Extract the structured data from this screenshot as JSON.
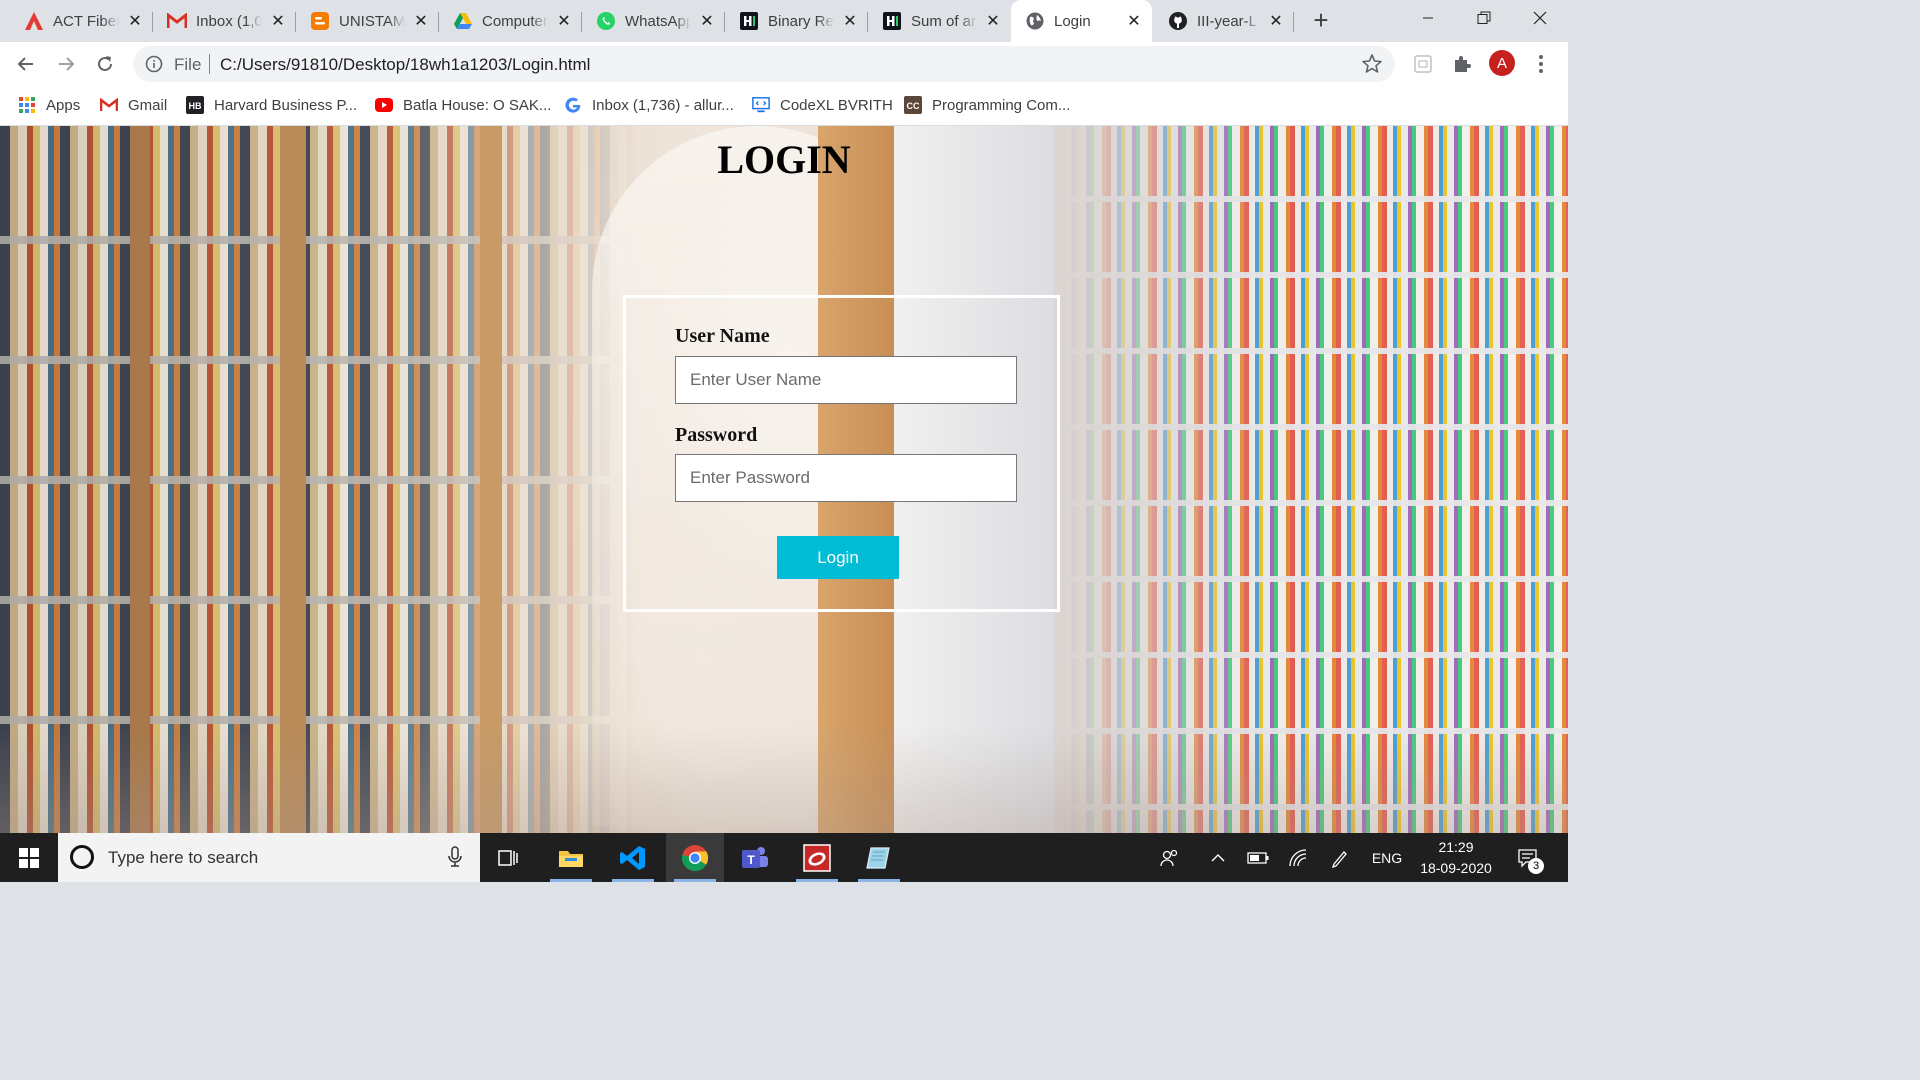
{
  "browser": {
    "tabs": [
      {
        "title": "ACT Fiber",
        "icon": "act-logo"
      },
      {
        "title": "Inbox (1,0",
        "icon": "gmail-icon"
      },
      {
        "title": "UNISTAM",
        "icon": "blogger-icon"
      },
      {
        "title": "Computer",
        "icon": "drive-icon"
      },
      {
        "title": "WhatsApp",
        "icon": "whatsapp-icon"
      },
      {
        "title": "Binary Re",
        "icon": "hackerrank-icon"
      },
      {
        "title": "Sum of ar",
        "icon": "hackerrank-icon"
      },
      {
        "title": "Login",
        "icon": "globe-icon"
      },
      {
        "title": "III-year-L",
        "icon": "github-icon"
      }
    ],
    "active_tab_index": 7,
    "address": {
      "scheme_label": "File",
      "url": "C:/Users/91810/Desktop/18wh1a1203/Login.html"
    },
    "profile_initial": "A",
    "bookmarks": [
      {
        "label": "Apps",
        "icon": "apps-grid-icon"
      },
      {
        "label": "Gmail",
        "icon": "gmail-icon"
      },
      {
        "label": "Harvard Business P...",
        "icon": "hbr-icon"
      },
      {
        "label": "Batla House: O SAK...",
        "icon": "youtube-icon"
      },
      {
        "label": "Inbox (1,736) - allur...",
        "icon": "google-icon"
      },
      {
        "label": "CodeXL BVRITH",
        "icon": "codexl-icon"
      },
      {
        "label": "Programming Com...",
        "icon": "cc-icon"
      }
    ]
  },
  "page": {
    "heading": "LOGIN",
    "username_label": "User Name",
    "username_placeholder": "Enter User Name",
    "password_label": "Password",
    "password_placeholder": "Enter Password",
    "login_button": "Login",
    "colors": {
      "button_bg": "#00bcd4",
      "box_border": "#ffffff"
    }
  },
  "taskbar": {
    "search_placeholder": "Type here to search",
    "language": "ENG",
    "time": "21:29",
    "date": "18-09-2020",
    "notification_count": "3",
    "apps": [
      "task-view-icon",
      "file-explorer-icon",
      "vscode-icon",
      "chrome-icon",
      "teams-icon",
      "app-red-icon",
      "app-notebook-icon"
    ]
  }
}
